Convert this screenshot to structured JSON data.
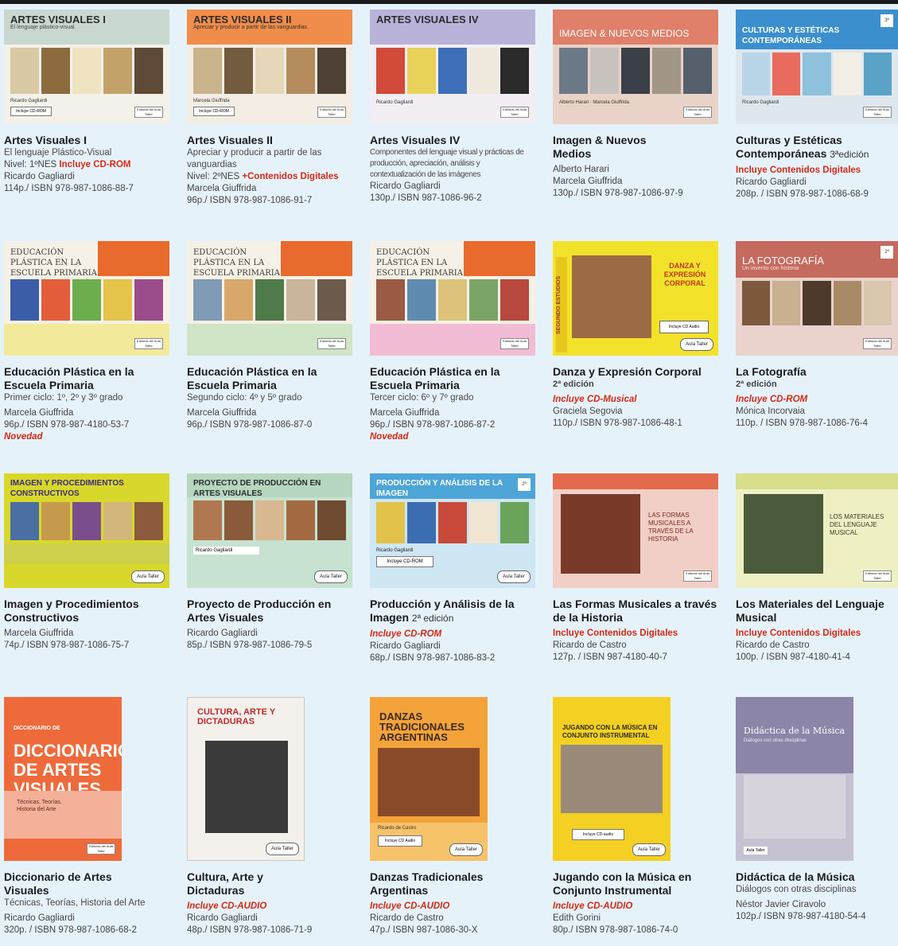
{
  "catalog": {
    "items": [
      {
        "cover_title": "ARTES VISUALES I",
        "cover_subtitle": "El lenguaje plástico-visual",
        "cover_author": "Ricardo Gagliardi",
        "cover_cd": "Incluye CD-ROM",
        "publisher": "Editorial del Aula Taller",
        "title": "Artes Visuales I",
        "subtitle": "El lenguaje Plástico-Visual",
        "level": "Nivel: 1ºNES",
        "highlight": "Incluye CD-ROM",
        "author": "Ricardo Gagliardi",
        "isbn": "114p./ ISBN 978-987-1086-88-7"
      },
      {
        "cover_title": "ARTES VISUALES II",
        "cover_subtitle": "Apreciar y producir a partir de las vanguardias",
        "cover_author": "Marcela Giuffrida",
        "cover_cd": "Incluye CD-ROM",
        "publisher": "Editorial del Aula Taller",
        "title": "Artes Visuales II",
        "subtitle": "Apreciar y producir a partir de las vanguardias",
        "level": "Nivel: 2ºNES",
        "highlight": "+Contenidos Digitales",
        "author": "Marcela Giuffrida",
        "isbn": "96p./ ISBN 978-987-1086-91-7"
      },
      {
        "cover_title": "ARTES VISUALES IV",
        "cover_author": "Ricardo Gagliardi",
        "publisher": "Editorial del Aula Taller",
        "title": "Artes Visuales IV",
        "subtitle": "Componentes del lenguaje visual y prácticas de producción, apreciación, análisis y contextualización de las imágenes",
        "author": "Ricardo Gagliardi",
        "isbn": "130p./ ISBN 987-1086-96-2"
      },
      {
        "cover_title": "IMAGEN & NUEVOS MEDIOS",
        "cover_author": "Alberto Harari · Marcela Giuffrida",
        "publisher": "Editorial del Aula Taller",
        "title": "Imagen & Nuevos Medios",
        "author": "Alberto Harari",
        "author2": "Marcela Giuffrida",
        "isbn": "130p./ ISBN 978-987-1086-97-9"
      },
      {
        "cover_title": "CULTURAS Y ESTÉTICAS CONTEMPORÁNEAS",
        "cover_author": "Ricardo Gagliardi",
        "publisher": "Editorial del Aula Taller",
        "title": "Culturas y Estéticas Contemporáneas",
        "edition": "3ªedición",
        "highlight": "Incluye Contenidos Digitales",
        "author": "Ricardo Gagliardi",
        "isbn": "208p. / ISBN 978-987-1086-68-9"
      },
      {
        "cover_title": "EDUCACIÓN PLÁSTICA EN LA ESCUELA PRIMARIA",
        "publisher": "Editorial del Aula Taller",
        "title": "Educación Plástica en la Escuela Primaria",
        "subtitle": "Primer ciclo: 1º, 2º y 3º grado",
        "author": "Marcela Giuffrida",
        "isbn": "96p./ ISBN 978-987-4180-53-7",
        "novelty": "Novedad"
      },
      {
        "cover_title": "EDUCACIÓN PLÁSTICA EN LA ESCUELA PRIMARIA",
        "publisher": "Editorial del Aula Taller",
        "title": "Educación Plástica en la Escuela Primaria",
        "subtitle": "Segundo ciclo: 4º y 5º grado",
        "author": "Marcela Giuffrida",
        "isbn": "96p./ ISBN 978-987-1086-87-0"
      },
      {
        "cover_title": "EDUCACIÓN PLÁSTICA EN LA ESCUELA PRIMARIA",
        "publisher": "Editorial del Aula Taller",
        "title": "Educación Plástica en la Escuela Primaria",
        "subtitle": "Tercer ciclo: 6º y 7º grado",
        "author": "Marcela Giuffrida",
        "isbn": "96p./ ISBN 978-987-1086-87-2",
        "novelty": "Novedad"
      },
      {
        "cover_title": "DANZA Y EXPRESIÓN CORPORAL",
        "cover_side": "SEGUNDO ESTUDIOS",
        "cover_cd": "Incluye CD Audio",
        "title": "Danza y Expresión Corporal",
        "edition": "2ª edición",
        "highlight": "Incluye CD-Musical",
        "author": "Graciela Segovia",
        "isbn": "110p./ ISBN 978-987-1086-48-1"
      },
      {
        "cover_title": "LA FOTOGRAFÍA",
        "cover_subtitle": "Un invento con historia",
        "publisher": "Editorial del Aula Taller",
        "title": "La Fotografía",
        "edition": "2ª edición",
        "highlight": "Incluye CD-ROM",
        "author": "Mónica Incorvaia",
        "isbn": "110p. / ISBN 978-987-1086-76-4"
      },
      {
        "cover_title": "IMAGEN Y PROCEDIMIENTOS CONSTRUCTIVOS",
        "title": "Imagen y Procedimientos Constructivos",
        "author": "Marcela Giuffrida",
        "isbn": "74p./ ISBN 978-987-1086-75-7"
      },
      {
        "cover_title": "PROYECTO DE PRODUCCIÓN EN ARTES VISUALES",
        "cover_author": "Ricardo Gagliardi",
        "title": "Proyecto de Producción en Artes Visuales",
        "author": "Ricardo Gagliardi",
        "isbn": "85p./ ISBN 978-987-1086-79-5"
      },
      {
        "cover_title": "PRODUCCIÓN Y ANÁLISIS DE LA IMAGEN",
        "cover_author": "Ricardo Gagliardi",
        "cover_cd": "Incluye CD-ROM",
        "title": "Producción y Análisis de la Imagen",
        "edition": "2ª edición",
        "highlight": "Incluye CD-ROM",
        "author": "Ricardo Gagliardi",
        "isbn": "68p./ ISBN 978-987-1086-83-2"
      },
      {
        "cover_title": "LAS FORMAS MUSICALES A TRAVÉS DE LA HISTORIA",
        "publisher": "Editorial del Aula Taller",
        "title": "Las Formas Musicales a través de la Historia",
        "highlight": "Incluye Contenidos Digitales",
        "author": "Ricardo de Castro",
        "isbn": "127p. / ISBN 987-4180-40-7"
      },
      {
        "cover_title": "LOS MATERIALES DEL LENGUAJE MUSICAL",
        "publisher": "Editorial del Aula Taller",
        "title": "Los Materiales del Lenguaje Musical",
        "highlight": "Incluye Contenidos Digitales",
        "author": "Ricardo de Castro",
        "isbn": "100p. / ISBN 987-4180-41-4"
      },
      {
        "cover_title": "DICCIONARIO DE ARTES VISUALES",
        "cover_subtitle": "Técnicas, Teorías, Historia del Arte",
        "publisher": "Editorial del Aula Taller",
        "title": "Diccionario de Artes Visuales",
        "subtitle": "Técnicas, Teorías, Historia del Arte",
        "author": "Ricardo Gagliardi",
        "isbn": "320p. / ISBN 978-987-1086-68-2"
      },
      {
        "cover_title": "CULTURA, ARTE Y DICTADURAS",
        "title": "Cultura, Arte y Dictaduras",
        "highlight": "Incluye CD-AUDIO",
        "author": "Ricardo Gagliardi",
        "isbn": "48p./ ISBN 978-987-1086-71-9"
      },
      {
        "cover_title": "DANZAS TRADICIONALES ARGENTINAS",
        "cover_author": "Ricardo de Castro",
        "cover_cd": "Incluye CD Audio",
        "title": "Danzas Tradicionales Argentinas",
        "highlight": "Incluye CD-AUDIO",
        "author": "Ricardo de Castro",
        "isbn": "47p./ ISBN 987-1086-30-X"
      },
      {
        "cover_title": "JUGANDO CON LA MÚSICA EN CONJUNTO INSTRUMENTAL",
        "cover_cd": "Incluye CD-audio",
        "title": "Jugando con la Música en Conjunto Instrumental",
        "highlight": "Incluye CD-AUDIO",
        "author": "Edith Gorini",
        "isbn": "80p./ ISBN 978-987-1086-74-0"
      },
      {
        "cover_title": "Didáctica de la Música",
        "cover_subtitle": "Diálogos con otras disciplinas",
        "publisher": "Aula Taller",
        "title": "Didáctica de la Música",
        "subtitle": "Diálogos con otras disciplinas",
        "author": "Néstor Javier Ciravolo",
        "isbn": "102p./ ISBN 978-987-4180-54-4"
      }
    ]
  },
  "colors": {
    "background": "#e6f2fa",
    "accent_red": "#d62a14"
  }
}
